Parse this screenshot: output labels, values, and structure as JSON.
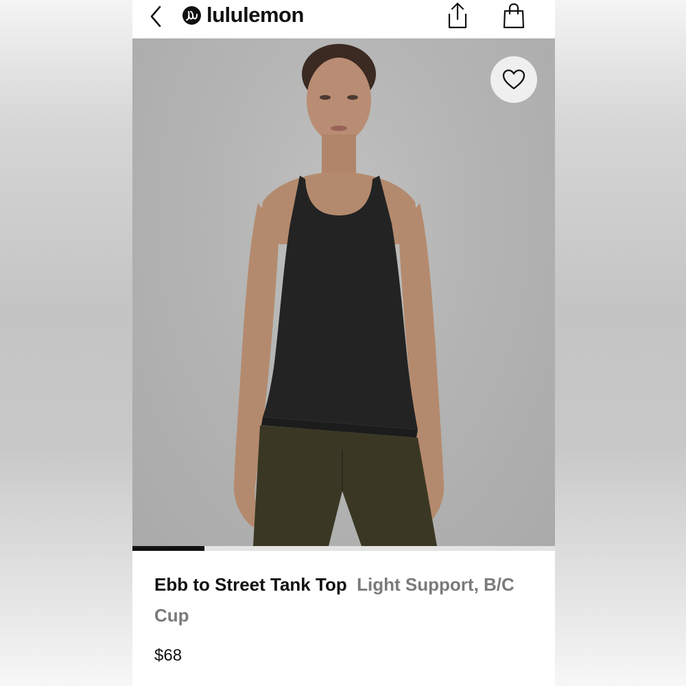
{
  "header": {
    "brand": "lululemon",
    "back_icon": "chevron-left-icon",
    "share_icon": "share-icon",
    "bag_icon": "shopping-bag-icon"
  },
  "product": {
    "name": "Ebb to Street Tank Top",
    "subtitle": "Light Support, B/C Cup",
    "price": "$68"
  },
  "gallery": {
    "favorite_icon": "heart-icon",
    "progress": 0.17
  },
  "colors": {
    "brand": "#111111",
    "subtitle": "#7a7a7a",
    "image_bg": "#b3b4b3"
  }
}
